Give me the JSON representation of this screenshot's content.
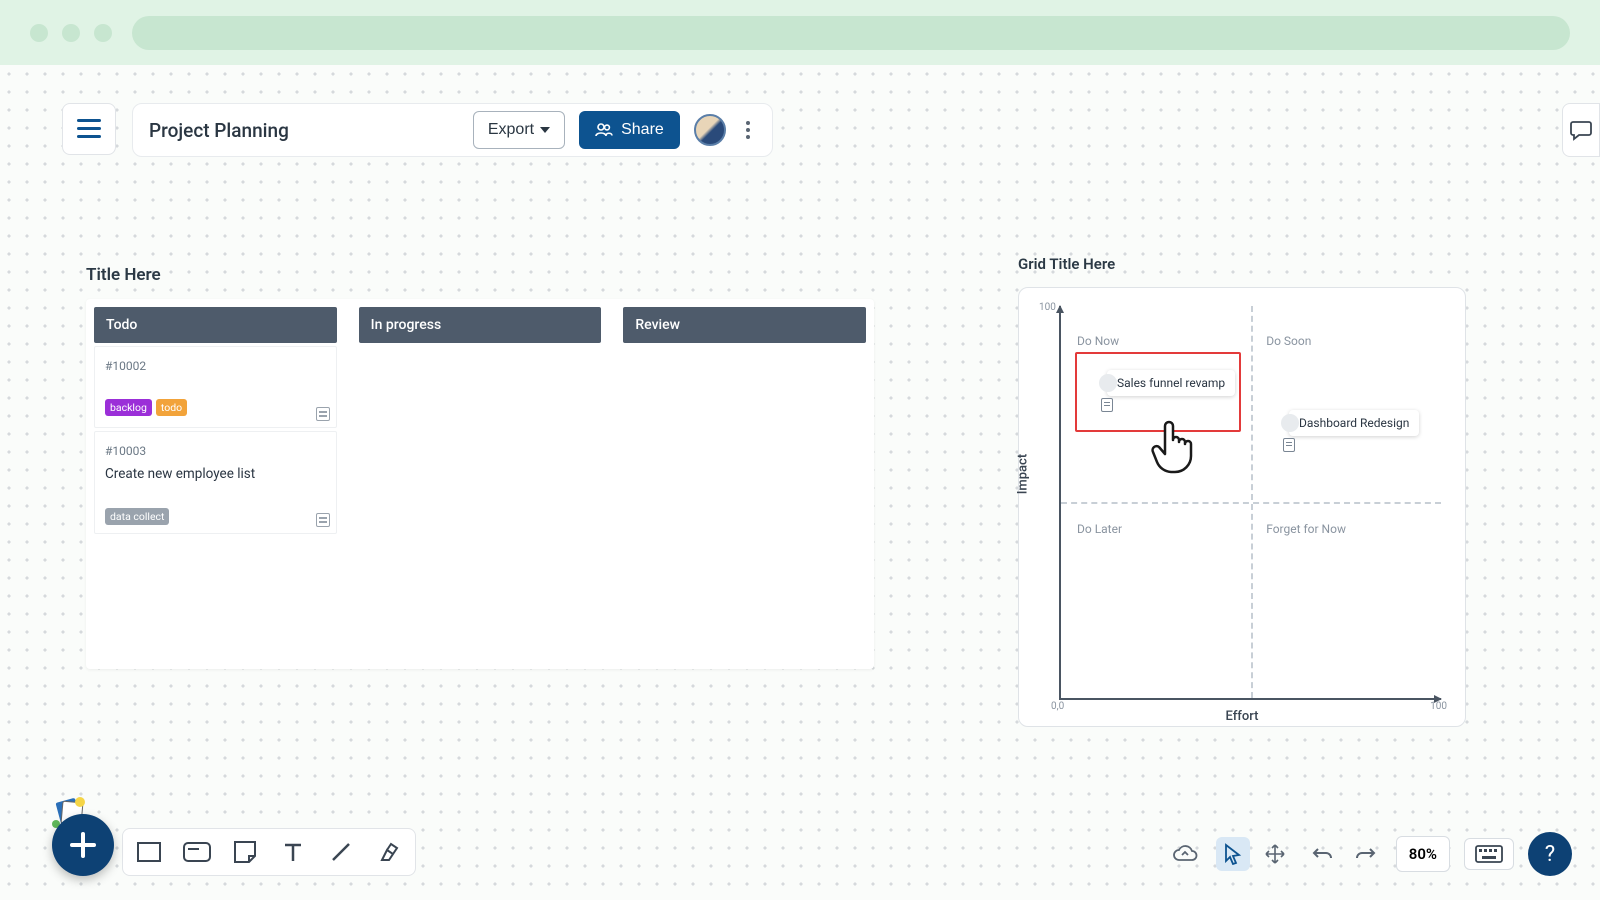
{
  "header": {
    "project_title": "Project Planning",
    "export_label": "Export",
    "share_label": "Share"
  },
  "kanban": {
    "title": "Title Here",
    "columns": [
      {
        "name": "Todo"
      },
      {
        "name": "In progress"
      },
      {
        "name": "Review"
      }
    ],
    "cards": {
      "c1": {
        "id": "#10002",
        "tags": {
          "t1": "backlog",
          "t2": "todo"
        }
      },
      "c2": {
        "id": "#10003",
        "title": "Create new employee list",
        "tags": {
          "t1": "data collect"
        }
      }
    }
  },
  "grid": {
    "title": "Grid Title Here",
    "y_axis": "Impact",
    "x_axis": "Effort",
    "y_max": "100",
    "origin": "0,0",
    "x_max": "100",
    "quadrants": {
      "tl": "Do Now",
      "tr": "Do Soon",
      "bl": "Do Later",
      "br": "Forget for Now"
    },
    "items": {
      "a": "Sales funnel revamp",
      "b": "Dashboard Redesign"
    }
  },
  "bottom": {
    "zoom": "80%"
  }
}
